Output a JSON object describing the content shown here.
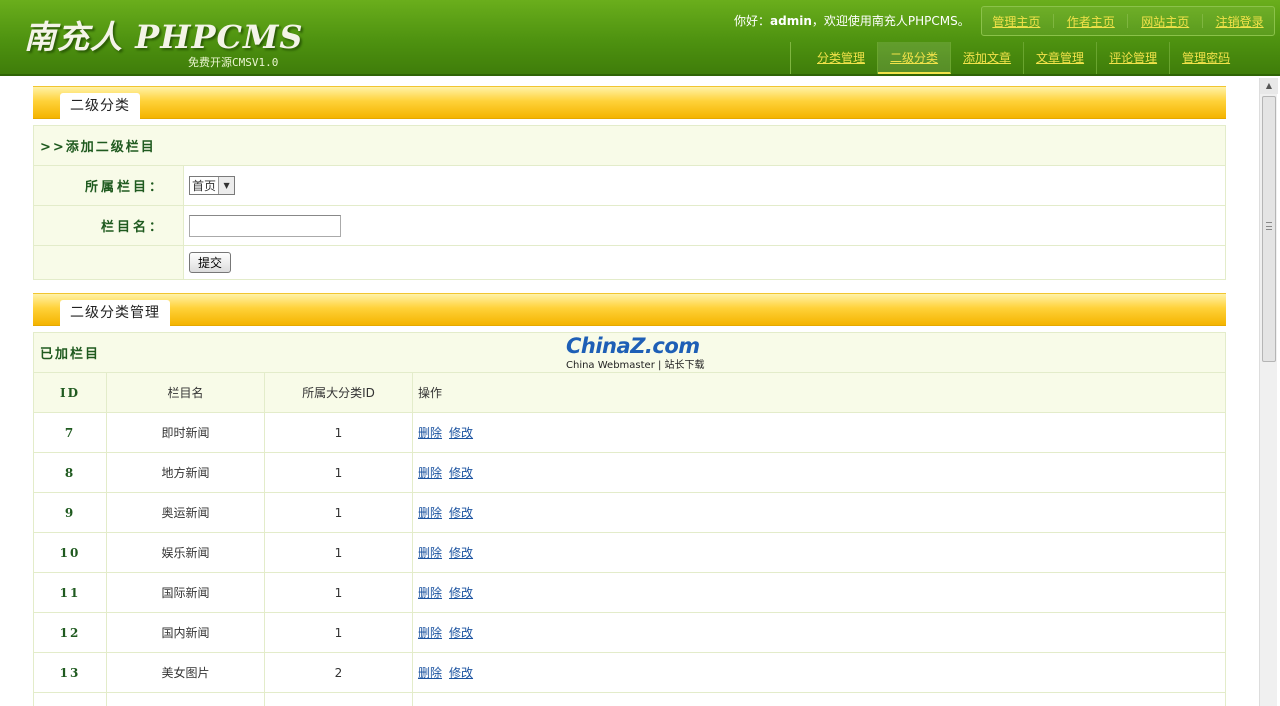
{
  "header": {
    "logo": "南充人 PHPCMS",
    "logo_sub": "免费开源CMSV1.0",
    "welcome_prefix": "你好：",
    "welcome_user": "admin",
    "welcome_suffix": "，欢迎使用南充人PHPCMS。",
    "top_links": [
      "管理主页",
      "作者主页",
      "网站主页",
      "注销登录"
    ],
    "nav": [
      "分类管理",
      "二级分类",
      "添加文章",
      "文章管理",
      "评论管理",
      "管理密码"
    ],
    "active_nav": "二级分类"
  },
  "add_panel": {
    "tab": "二级分类",
    "section_title": ">>添加二级栏目",
    "parent_label": "所属栏目：",
    "parent_value": "首页",
    "name_label": "栏目名：",
    "name_value": "",
    "submit_label": "提交"
  },
  "manage_panel": {
    "tab": "二级分类管理",
    "caption": "已加栏目",
    "columns": [
      "ID",
      "栏目名",
      "所属大分类ID",
      "操作"
    ],
    "rows": [
      {
        "id": "7",
        "name": "即时新闻",
        "parent_id": "1"
      },
      {
        "id": "8",
        "name": "地方新闻",
        "parent_id": "1"
      },
      {
        "id": "9",
        "name": "奥运新闻",
        "parent_id": "1"
      },
      {
        "id": "10",
        "name": "娱乐新闻",
        "parent_id": "1"
      },
      {
        "id": "11",
        "name": "国际新闻",
        "parent_id": "1"
      },
      {
        "id": "12",
        "name": "国内新闻",
        "parent_id": "1"
      },
      {
        "id": "13",
        "name": "美女图片",
        "parent_id": "2"
      },
      {
        "id": "",
        "name": "",
        "parent_id": ""
      }
    ],
    "delete_label": "删除",
    "edit_label": "修改"
  },
  "watermark": {
    "brand_a": "China",
    "brand_z": "Z",
    "brand_b": ".com",
    "tagline": "China Webmaster | 站长下载"
  }
}
